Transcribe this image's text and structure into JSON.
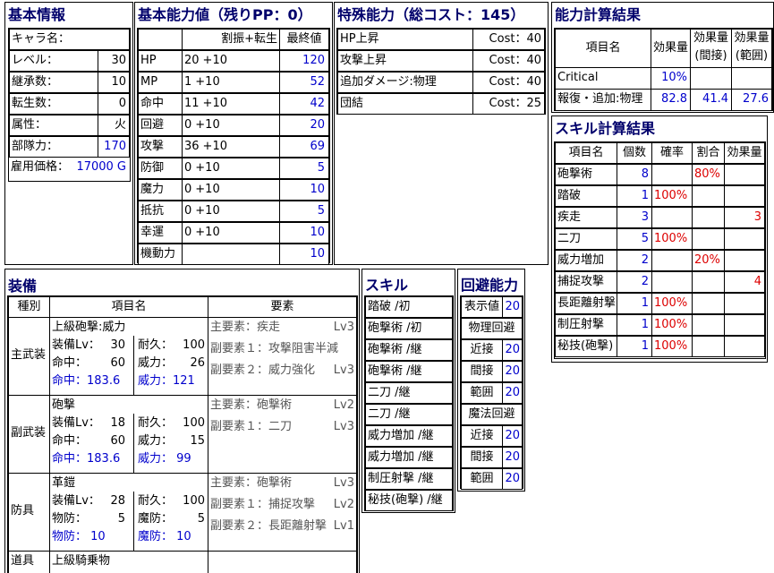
{
  "basic_info": {
    "title": "基本情報",
    "rows": [
      {
        "label": "キャラ名：",
        "value": ""
      },
      {
        "label": "レベル：",
        "value": "30"
      },
      {
        "label": "継承数：",
        "value": "10"
      },
      {
        "label": "転生数：",
        "value": "0"
      },
      {
        "label": "属性：",
        "value": "火"
      },
      {
        "label": "部隊力：",
        "value": "170"
      },
      {
        "label": "雇用価格：",
        "value": "17000 G"
      }
    ]
  },
  "stats": {
    "title": "基本能力値（残りPP：0）",
    "col_alloc": "割振+転生",
    "col_final": "最終値",
    "rows": [
      {
        "name": "HP",
        "base": "20",
        "bonus": "+10",
        "final": "120"
      },
      {
        "name": "MP",
        "base": "1",
        "bonus": "+10",
        "final": "52"
      },
      {
        "name": "命中",
        "base": "11",
        "bonus": "+10",
        "final": "42"
      },
      {
        "name": "回避",
        "base": "0",
        "bonus": "+10",
        "final": "20"
      },
      {
        "name": "攻撃",
        "base": "36",
        "bonus": "+10",
        "final": "69"
      },
      {
        "name": "防御",
        "base": "0",
        "bonus": "+10",
        "final": "5"
      },
      {
        "name": "魔力",
        "base": "0",
        "bonus": "+10",
        "final": "10"
      },
      {
        "name": "抵抗",
        "base": "0",
        "bonus": "+10",
        "final": "5"
      },
      {
        "name": "幸運",
        "base": "0",
        "bonus": "+10",
        "final": "10"
      },
      {
        "name": "機動力",
        "base": "",
        "bonus": "",
        "final": "10"
      }
    ]
  },
  "special": {
    "title": "特殊能力（総コスト：145）",
    "rows": [
      {
        "name": "HP上昇",
        "cost": "Cost：40"
      },
      {
        "name": "攻撃上昇",
        "cost": "Cost：40"
      },
      {
        "name": "追加ダメージ:物理",
        "cost": "Cost：40"
      },
      {
        "name": "団結",
        "cost": "Cost：25"
      }
    ]
  },
  "calc": {
    "title": "能力計算結果",
    "col_item": "項目名",
    "col_effect": "効果量",
    "col_indirect": "効果量\n(間接)",
    "col_range": "効果量\n(範囲)",
    "rows": [
      {
        "name": "Critical",
        "effect": "10%",
        "indirect": "",
        "range": ""
      },
      {
        "name": "報復・追加:物理",
        "effect": "82.8",
        "indirect": "41.4",
        "range": "27.6"
      }
    ]
  },
  "skill_calc": {
    "title": "スキル計算結果",
    "headers": [
      "項目名",
      "個数",
      "確率",
      "割合",
      "効果量"
    ],
    "rows": [
      {
        "name": "砲撃術",
        "count": "8",
        "prob": "",
        "ratio": "80%",
        "effect": ""
      },
      {
        "name": "踏破",
        "count": "1",
        "prob": "100%",
        "ratio": "",
        "effect": ""
      },
      {
        "name": "疾走",
        "count": "3",
        "prob": "",
        "ratio": "",
        "effect": "3"
      },
      {
        "name": "二刀",
        "count": "5",
        "prob": "100%",
        "ratio": "",
        "effect": ""
      },
      {
        "name": "威力増加",
        "count": "2",
        "prob": "",
        "ratio": "20%",
        "effect": ""
      },
      {
        "name": "捕捉攻撃",
        "count": "2",
        "prob": "",
        "ratio": "",
        "effect": "4"
      },
      {
        "name": "長距離射撃",
        "count": "1",
        "prob": "100%",
        "ratio": "",
        "effect": ""
      },
      {
        "name": "制圧射撃",
        "count": "1",
        "prob": "100%",
        "ratio": "",
        "effect": ""
      },
      {
        "name": "秘技(砲撃)",
        "count": "1",
        "prob": "100%",
        "ratio": "",
        "effect": ""
      }
    ]
  },
  "equipment": {
    "title": "装備",
    "headers": [
      "種別",
      "項目名",
      "要素"
    ],
    "main": {
      "type": "主武装",
      "name": "上級砲撃:威力",
      "lv_label": "装備Lv：",
      "lv": "30",
      "dur_label": "耐久：",
      "dur": "100",
      "hit_label": "命中：",
      "hit": "60",
      "pow_label": "威力：",
      "pow": "26",
      "hit_total": "命中：183.6",
      "pow_total": "威力：121",
      "elements": [
        {
          "text": "主要素：疾走",
          "lv": "Lv3"
        },
        {
          "text": "副要素１：攻撃阻害半減",
          "lv": ""
        },
        {
          "text": "副要素２：威力強化",
          "lv": "Lv3"
        }
      ]
    },
    "sub": {
      "type": "副武装",
      "name": "砲撃",
      "lv_label": "装備Lv：",
      "lv": "18",
      "dur_label": "耐久：",
      "dur": "100",
      "hit_label": "命中：",
      "hit": "60",
      "pow_label": "威力：",
      "pow": "15",
      "hit_total": "命中：183.6",
      "pow_total": "威力：  99",
      "elements": [
        {
          "text": "主要素：砲撃術",
          "lv": "Lv2"
        },
        {
          "text": "副要素１：二刀",
          "lv": "Lv3"
        }
      ]
    },
    "armor": {
      "type": "防具",
      "name": "革鎧",
      "lv_label": "装備Lv：",
      "lv": "28",
      "dur_label": "耐久：",
      "dur": "100",
      "pdef_label": "物防：",
      "pdef": "5",
      "mdef_label": "魔防：",
      "mdef": "5",
      "pdef_total": "物防：  10",
      "mdef_total": "魔防：  10",
      "elements": [
        {
          "text": "主要素：砲撃術",
          "lv": "Lv3"
        },
        {
          "text": "副要素１：捕捉攻撃",
          "lv": "Lv2"
        },
        {
          "text": "副要素２：長距離射撃",
          "lv": "Lv1"
        }
      ]
    },
    "tool": {
      "type": "道具",
      "name": "上級騎乗物"
    }
  },
  "skills": {
    "title": "スキル",
    "items": [
      "踏破 /初",
      "砲撃術 /初",
      "砲撃術 /継",
      "砲撃術 /継",
      "二刀 /継",
      "二刀 /継",
      "威力増加 /継",
      "威力増加 /継",
      "制圧射撃 /継",
      "秘技(砲撃) /継"
    ]
  },
  "evasion": {
    "title": "回避能力",
    "display_label": "表示値",
    "display_value": "20",
    "phys_title": "物理回避",
    "phys": [
      {
        "label": "近接",
        "value": "20"
      },
      {
        "label": "間接",
        "value": "20"
      },
      {
        "label": "範囲",
        "value": "20"
      }
    ],
    "mag_title": "魔法回避",
    "mag": [
      {
        "label": "近接",
        "value": "20"
      },
      {
        "label": "間接",
        "value": "20"
      },
      {
        "label": "範囲",
        "value": "20"
      }
    ]
  }
}
